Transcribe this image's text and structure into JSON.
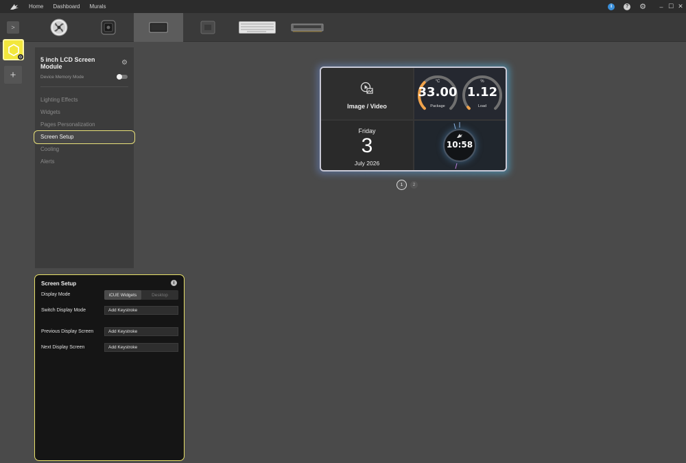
{
  "titlebar": {
    "nav": [
      "Home",
      "Dashboard",
      "Murals"
    ],
    "info_badge": "i",
    "help_badge": "?",
    "window_controls": [
      "–",
      "☐",
      "✕"
    ]
  },
  "device_strip": {
    "expand_label": ">",
    "devices": [
      {
        "name": "fan-device-icon"
      },
      {
        "name": "cooler-pump-device-icon"
      },
      {
        "name": "lcd-screen-device-icon",
        "selected": true
      },
      {
        "name": "hub-device-icon"
      },
      {
        "name": "keyboard-device-icon"
      },
      {
        "name": "dram-device-icon"
      }
    ]
  },
  "rail": {
    "add_label": "+",
    "badge": "⚙"
  },
  "sidebar": {
    "device_name": "5 inch LCD Screen Module",
    "memory_mode_label": "Device Memory Mode",
    "memory_mode_on": false,
    "menu": [
      "Lighting Effects",
      "Widgets",
      "Pages Personalization",
      "Screen Setup",
      "Cooling",
      "Alerts"
    ],
    "active_index": 3
  },
  "screen_setup": {
    "title": "Screen Setup",
    "info": "i",
    "display_mode_label": "Display Mode",
    "display_mode_options": [
      "iCUE Widgets",
      "Desktop"
    ],
    "display_mode_selected": "iCUE Widgets",
    "switch_label": "Switch Display Mode",
    "switch_value": "Add Keystroke",
    "previous_label": "Previous Display Screen",
    "previous_value": "Add Keystroke",
    "next_label": "Next Display Screen",
    "next_value": "Add Keystroke"
  },
  "preview": {
    "media_label": "Image / Video",
    "gauge1": {
      "unit": "°C",
      "value": "33.00",
      "label": "Package",
      "fill": 0.33
    },
    "gauge2": {
      "unit": "%",
      "value": "1.12",
      "label": "Load",
      "fill": 0.011
    },
    "date": {
      "day": "Friday",
      "number": "3",
      "month": "July 2026"
    },
    "clock": "10:58",
    "pages": [
      "1",
      "2"
    ],
    "current_page": "1"
  },
  "colors": {
    "accent_yellow": "#e9e26a",
    "device_yellow": "#f2e73d",
    "gauge_orange": "#f0a24a",
    "gauge_track": "#707070",
    "info_blue": "#3b8fd9"
  }
}
